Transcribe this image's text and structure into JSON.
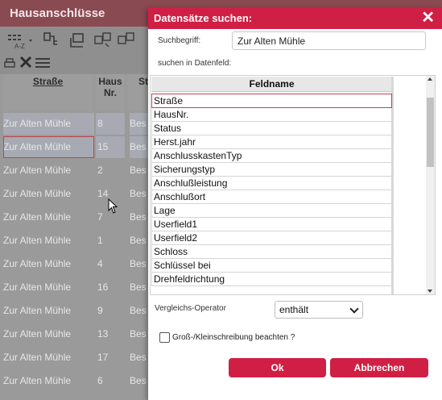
{
  "background": {
    "title": "Hausanschlüsse",
    "columns": [
      "Straße",
      "Haus Nr.",
      "St"
    ],
    "rows": [
      {
        "street": "Zur Alten Mühle",
        "nr": "8",
        "st": "Bes"
      },
      {
        "street": "Zur Alten Mühle",
        "nr": "15",
        "st": "Bes"
      },
      {
        "street": "Zur Alten Mühle",
        "nr": "2",
        "st": "Bes"
      },
      {
        "street": "Zur Alten Mühle",
        "nr": "14",
        "st": "Bes"
      },
      {
        "street": "Zur Alten Mühle",
        "nr": "7",
        "st": "Bes"
      },
      {
        "street": "Zur Alten Mühle",
        "nr": "1",
        "st": "Bes"
      },
      {
        "street": "Zur Alten Mühle",
        "nr": "4",
        "st": "Bes"
      },
      {
        "street": "Zur Alten Mühle",
        "nr": "16",
        "st": "Bes"
      },
      {
        "street": "Zur Alten Mühle",
        "nr": "9",
        "st": "Bes"
      },
      {
        "street": "Zur Alten Mühle",
        "nr": "13",
        "st": "Bes"
      },
      {
        "street": "Zur Alten Mühle",
        "nr": "17",
        "st": "Bes"
      },
      {
        "street": "Zur Alten Mühle",
        "nr": "6",
        "st": "Bes"
      }
    ],
    "toolbar_icons": [
      "sort-az-icon",
      "hierarchy-icon",
      "layer-icon",
      "copy-icon",
      "copy-alt-icon",
      "print-icon",
      "excel-icon",
      "grid-icon"
    ]
  },
  "dialog": {
    "title": "Datensätze suchen:",
    "search_label": "Suchbegriff:",
    "search_value": "Zur Alten Mühle",
    "field_label": "suchen in Datenfeld:",
    "list_header": "Feldname",
    "fields": [
      "Straße",
      "HausNr.",
      "Status",
      "Herst.jahr",
      "AnschlusskastenTyp",
      "Sicherungstyp",
      "Anschlußleistung",
      "Anschlußort",
      "Lage",
      "Userfield1",
      "Userfield2",
      "Schloss",
      "Schlüssel bei",
      "Drehfeldrichtung"
    ],
    "operator_label": "Vergleichs-Operator",
    "operator_value": "enthält",
    "case_label": "Groß-/Kleinschreibung beachten ?",
    "ok_label": "Ok",
    "cancel_label": "Abbrechen"
  },
  "colors": {
    "accent": "#d01f45",
    "background_title": "#8a4a52"
  }
}
